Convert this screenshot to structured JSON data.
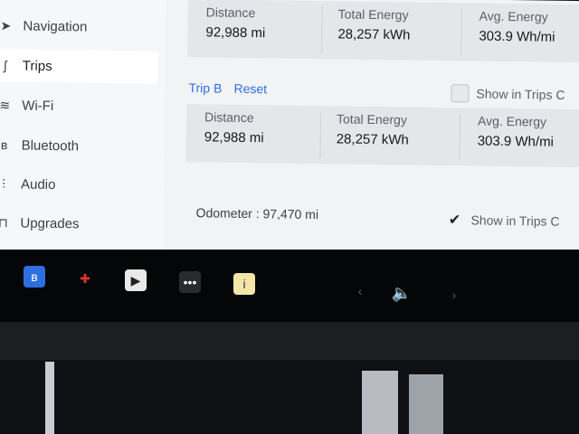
{
  "sidebar": {
    "items": [
      {
        "icon": "car-icon",
        "label": "Navigation"
      },
      {
        "icon": "trips-icon",
        "label": "Trips"
      },
      {
        "icon": "wifi-icon",
        "label": "Wi-Fi"
      },
      {
        "icon": "bluetooth-icon",
        "label": "Bluetooth"
      },
      {
        "icon": "audio-icon",
        "label": "Audio"
      },
      {
        "icon": "lock-icon",
        "label": "Upgrades"
      }
    ]
  },
  "trip_a": {
    "distance_label": "Distance",
    "distance_value": "92,988 mi",
    "energy_label": "Total Energy",
    "energy_value": "28,257 kWh",
    "avg_label": "Avg. Energy",
    "avg_value": "303.9 Wh/mi"
  },
  "trip_b": {
    "title": "Trip B",
    "reset_label": "Reset",
    "show_label": "Show in Trips C",
    "distance_label": "Distance",
    "distance_value": "92,988 mi",
    "energy_label": "Total Energy",
    "energy_value": "28,257 kWh",
    "avg_label": "Avg. Energy",
    "avg_value": "303.9 Wh/mi"
  },
  "odometer": {
    "label": "Odometer :",
    "value": "97,470 mi",
    "show_label": "Show in Trips C",
    "checked": true
  },
  "taskbar": {
    "icons": [
      "bluetooth-icon",
      "joystick-icon",
      "media-player-icon",
      "more-apps-icon",
      "notes-icon"
    ],
    "volume_icon": "volume-icon",
    "prev_icon": "chevron-left-icon",
    "next_icon": "chevron-right-icon"
  },
  "colors": {
    "accent_blue": "#2f6ee6",
    "bluetooth_tile": "#2d6fe0"
  }
}
